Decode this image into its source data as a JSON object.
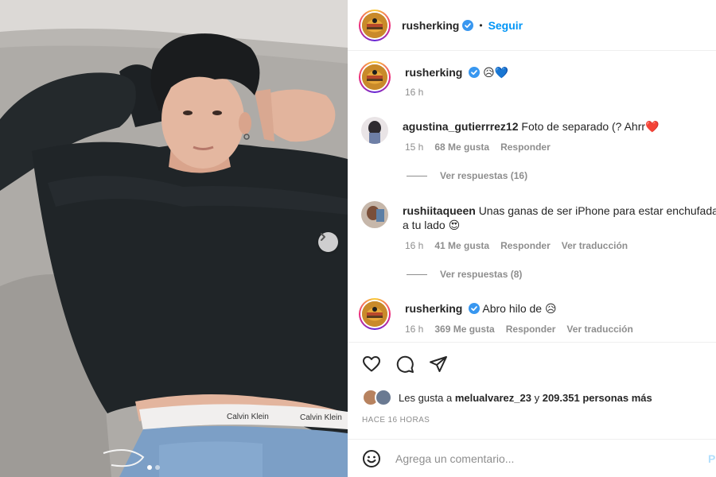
{
  "post": {
    "author": "rusherking",
    "follow_label": "Seguir",
    "separator": "•",
    "caption_emoji": "😥💙",
    "caption_time": "16 h"
  },
  "comments": [
    {
      "user": "agustina_gutierrrez12",
      "text": "Foto de separado (? Ahrr❤️",
      "time": "15 h",
      "likes": "68 Me gusta",
      "reply_label": "Responder",
      "view_replies": "Ver respuestas (16)"
    },
    {
      "user": "rushiitaqueen",
      "text": "Unas ganas de ser iPhone para estar enchufada",
      "text_line2": "a tu lado 😍",
      "time": "16 h",
      "likes": "41 Me gusta",
      "reply_label": "Responder",
      "translate_label": "Ver traducción",
      "view_replies": "Ver respuestas (8)"
    },
    {
      "user": "rusherking",
      "text": "Abro hilo de 😥",
      "time": "16 h",
      "likes": "369 Me gusta",
      "reply_label": "Responder",
      "translate_label": "Ver traducción"
    }
  ],
  "likes_summary": {
    "prefix": "Les gusta a",
    "first_user": "melualvarez_23",
    "joiner": "y",
    "others": "209.351 personas más"
  },
  "timestamp": "HACE 16 HORAS",
  "comment_input": {
    "placeholder": "Agrega un comentario...",
    "publish_label": "Publicar"
  },
  "photo": {
    "waistband_text_1": "Calvin Klein",
    "waistband_text_2": "Calvin Klein"
  },
  "icons": {
    "verified": "verified-badge-icon",
    "like": "heart-icon",
    "comment": "comment-bubble-icon",
    "share": "paper-plane-icon",
    "emoji": "smiley-icon",
    "next": "chevron-right-icon"
  },
  "colors": {
    "accent": "#0095f6",
    "text": "#262626",
    "secondary": "#8e8e8e",
    "border": "#efefef",
    "publish_disabled": "#b2dffc"
  },
  "carousel": {
    "total": 2,
    "current": 1
  }
}
